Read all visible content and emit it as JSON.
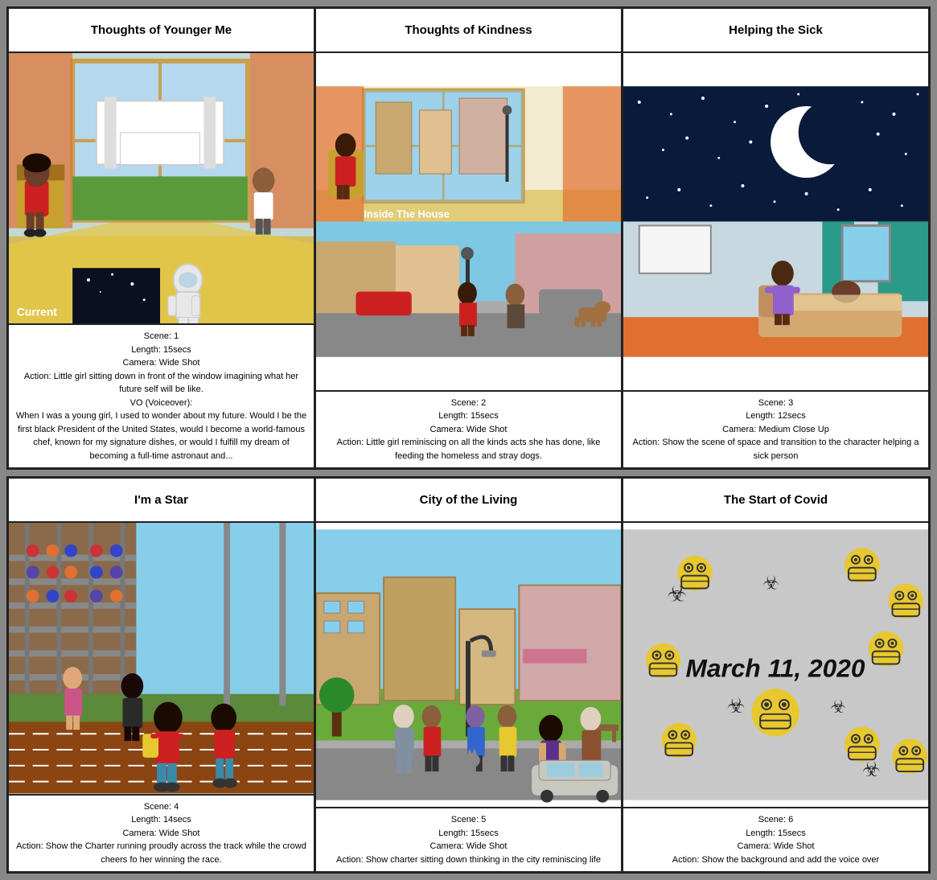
{
  "rows": [
    {
      "cells": [
        {
          "title": "Thoughts of Younger Me",
          "scene": "kitchen",
          "sceneLabel": "Current",
          "info": {
            "scene": "Scene: 1",
            "length": "Length: 15secs",
            "camera": "Camera: Wide Shot",
            "action": "Action: Little girl sitting down in front of the window imagining what her future self will be like.",
            "vo": "VO (Voiceover):",
            "voText": "When I was a young girl, I used to wonder about my future. Would I be the first black President of the United States, would I become a world-famous chef, known for my signature dishes, or would I fulfill my dream of becoming a full-time astronaut and..."
          }
        },
        {
          "title": "Thoughts of Kindness",
          "scene": "street",
          "sceneLabel": "Inside The House",
          "info": {
            "scene": "Scene: 2",
            "length": "Length: 15secs",
            "camera": "Camera: Wide Shot",
            "action": "Action: Little girl reminiscing on all the kinds acts she has done, like feeding the homeless and stray dogs."
          }
        },
        {
          "title": "Helping the Sick",
          "scene": "space-bedroom",
          "info": {
            "scene": "Scene: 3",
            "length": "Length: 12secs",
            "camera": "Camera: Medium Close Up",
            "action": "Action: Show the scene of space and transition to the character helping a sick person"
          }
        }
      ]
    },
    {
      "cells": [
        {
          "title": "I'm a Star",
          "scene": "track",
          "info": {
            "scene": "Scene: 4",
            "length": "Length: 14secs",
            "camera": "Camera: Wide Shot",
            "action": "Action: Show the Charter running proudly across the track while the crowd cheers fo her winning the race."
          }
        },
        {
          "title": "City of the Living",
          "scene": "city",
          "info": {
            "scene": "Scene: 5",
            "length": "Length: 15secs",
            "camera": "Camera: Wide Shot",
            "action": "Action: Show charter sitting down thinking in the city reminiscing life"
          }
        },
        {
          "title": "The Start of Covid",
          "scene": "covid",
          "info": {
            "scene": "Scene: 6",
            "length": "Length: 15secs",
            "camera": "Camera: Wide Shot",
            "action": "Action: Show the background and add the voice over"
          }
        }
      ]
    }
  ],
  "colors": {
    "border": "#222222",
    "titleBg": "#ffffff",
    "infoBg": "#ffffff"
  }
}
